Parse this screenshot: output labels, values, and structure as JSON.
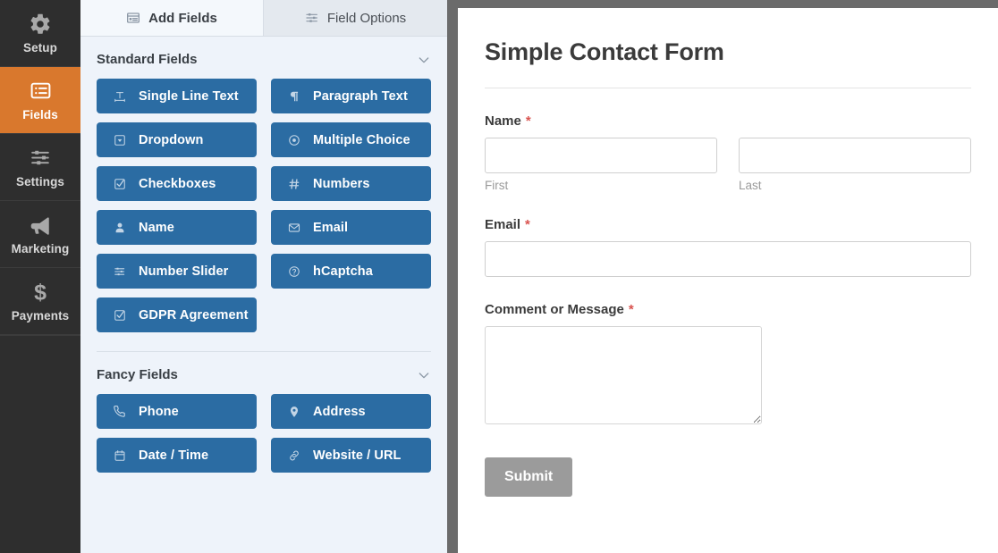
{
  "sidebar": {
    "items": [
      {
        "label": "Setup",
        "icon": "gear-icon",
        "active": false
      },
      {
        "label": "Fields",
        "icon": "list-icon",
        "active": true
      },
      {
        "label": "Settings",
        "icon": "sliders-icon",
        "active": false
      },
      {
        "label": "Marketing",
        "icon": "megaphone-icon",
        "active": false
      },
      {
        "label": "Payments",
        "icon": "dollar-icon",
        "active": false
      }
    ],
    "active_color": "#d9782d",
    "background_color": "#2e2e2e"
  },
  "panel": {
    "tabs": [
      {
        "label": "Add Fields",
        "icon": "add-fields-icon",
        "active": true
      },
      {
        "label": "Field Options",
        "icon": "field-options-icon",
        "active": false
      }
    ],
    "sections": [
      {
        "title": "Standard Fields",
        "collapse_icon": "chevron-down-icon",
        "fields": [
          {
            "label": "Single Line Text",
            "icon": "text-width-icon"
          },
          {
            "label": "Paragraph Text",
            "icon": "paragraph-icon"
          },
          {
            "label": "Dropdown",
            "icon": "caret-square-down-icon"
          },
          {
            "label": "Multiple Choice",
            "icon": "radio-circle-icon"
          },
          {
            "label": "Checkboxes",
            "icon": "check-square-icon"
          },
          {
            "label": "Numbers",
            "icon": "hashtag-icon"
          },
          {
            "label": "Name",
            "icon": "user-icon"
          },
          {
            "label": "Email",
            "icon": "envelope-icon"
          },
          {
            "label": "Number Slider",
            "icon": "sliders-icon"
          },
          {
            "label": "hCaptcha",
            "icon": "question-circle-icon"
          },
          {
            "label": "GDPR Agreement",
            "icon": "check-square-icon"
          }
        ]
      },
      {
        "title": "Fancy Fields",
        "collapse_icon": "chevron-down-icon",
        "fields": [
          {
            "label": "Phone",
            "icon": "phone-icon"
          },
          {
            "label": "Address",
            "icon": "map-marker-icon"
          },
          {
            "label": "Date / Time",
            "icon": "calendar-icon"
          },
          {
            "label": "Website / URL",
            "icon": "link-icon"
          }
        ]
      }
    ],
    "field_button_color": "#2b6ca3",
    "background_color": "#eef3fa"
  },
  "preview": {
    "form_title": "Simple Contact Form",
    "required_mark": "*",
    "required_color": "#d9534f",
    "fields": [
      {
        "label": "Name",
        "required": true,
        "type": "name",
        "sublabels": [
          "First",
          "Last"
        ],
        "values": [
          "",
          ""
        ]
      },
      {
        "label": "Email",
        "required": true,
        "type": "text",
        "value": ""
      },
      {
        "label": "Comment or Message",
        "required": true,
        "type": "textarea",
        "value": ""
      }
    ],
    "submit_label": "Submit",
    "submit_color": "#9b9b9b"
  }
}
